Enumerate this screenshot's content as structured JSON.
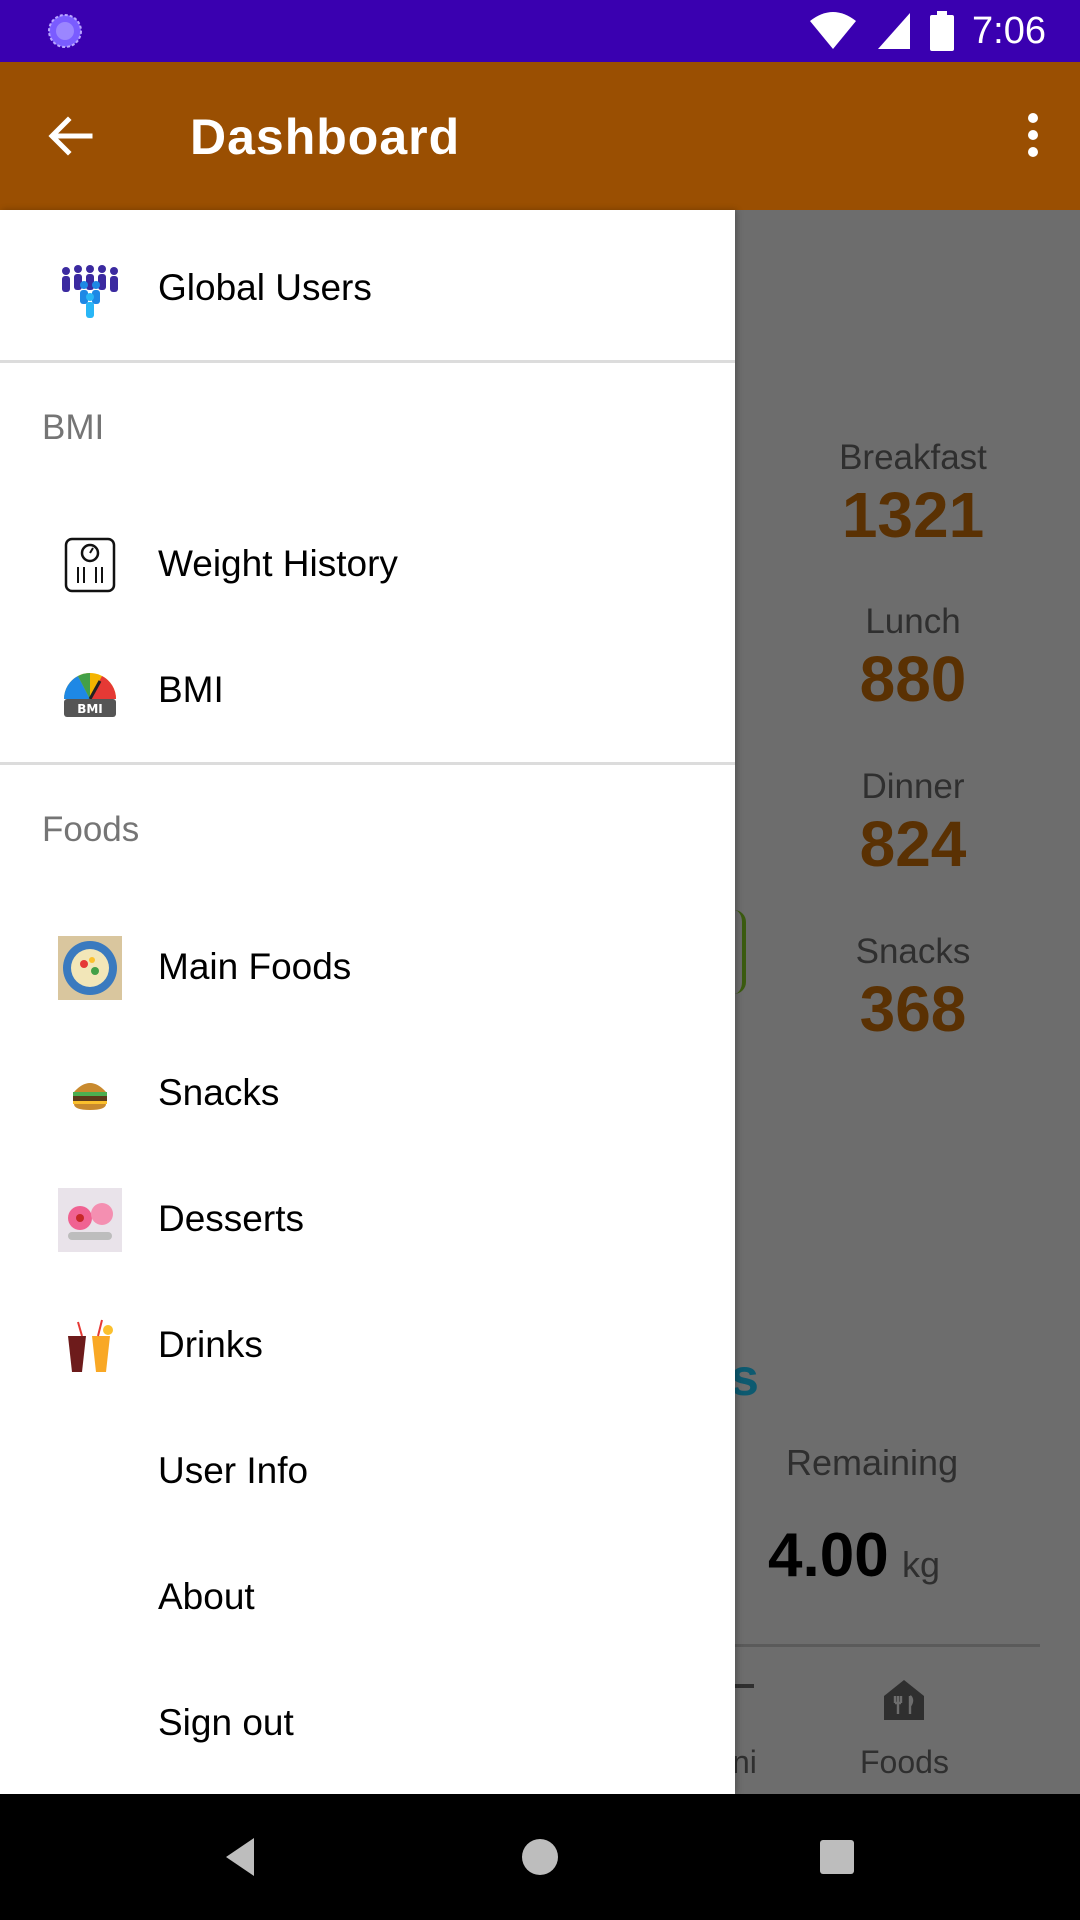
{
  "status_bar": {
    "time": "7:06",
    "icons": [
      "loading-icon",
      "wifi-icon",
      "signal-icon",
      "battery-icon"
    ],
    "color": "#3a00b0"
  },
  "app_bar": {
    "title": "Dashboard",
    "color": "#9a4f02"
  },
  "drawer": {
    "top_item": {
      "label": "Global Users",
      "icon": "users-icon"
    },
    "sections": [
      {
        "header": "BMI",
        "items": [
          {
            "label": "Weight History",
            "icon": "scale-icon"
          },
          {
            "label": "BMI",
            "icon": "bmi-gauge-icon"
          }
        ]
      },
      {
        "header": "Foods",
        "items": [
          {
            "label": "Main Foods",
            "icon": "plate-icon"
          },
          {
            "label": "Snacks",
            "icon": "burger-icon"
          },
          {
            "label": "Desserts",
            "icon": "ice-cream-icon"
          },
          {
            "label": "Drinks",
            "icon": "drinks-icon"
          },
          {
            "label": "User Info",
            "icon": ""
          },
          {
            "label": "About",
            "icon": ""
          },
          {
            "label": "Sign out",
            "icon": ""
          }
        ]
      }
    ]
  },
  "dashboard": {
    "meals": [
      {
        "label": "Breakfast",
        "value": "1321"
      },
      {
        "label": "Lunch",
        "value": "880"
      },
      {
        "label": "Dinner",
        "value": "824"
      },
      {
        "label": "Snacks",
        "value": "368"
      }
    ],
    "partial_heading": "s",
    "remaining_label": "Remaining",
    "remaining_value": "4.00",
    "remaining_unit": "kg",
    "bottom_nav": {
      "bmi_partial": "ni",
      "foods": "Foods"
    }
  },
  "nav_bar": {
    "buttons": [
      "back-button",
      "home-button",
      "recents-button"
    ]
  }
}
